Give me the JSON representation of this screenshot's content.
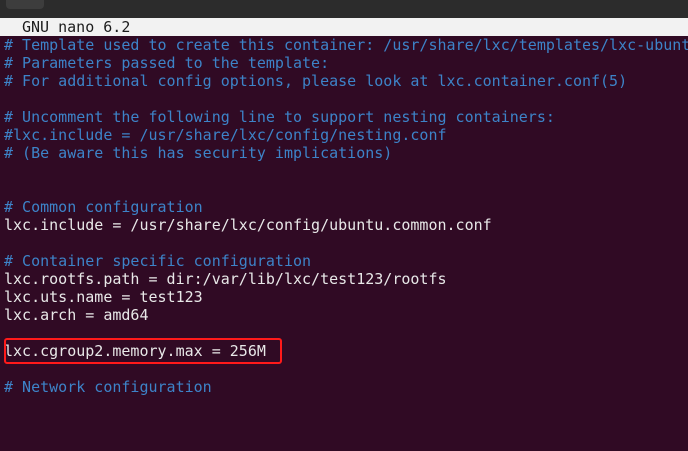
{
  "titlebar": {
    "text": "GNU nano 6.2"
  },
  "editor": {
    "lines": [
      {
        "kind": "comment",
        "text": "# Template used to create this container: /usr/share/lxc/templates/lxc-ubuntu"
      },
      {
        "kind": "comment",
        "text": "# Parameters passed to the template:"
      },
      {
        "kind": "comment",
        "text": "# For additional config options, please look at lxc.container.conf(5)"
      },
      {
        "kind": "blank",
        "text": ""
      },
      {
        "kind": "comment",
        "text": "# Uncomment the following line to support nesting containers:"
      },
      {
        "kind": "comment",
        "text": "#lxc.include = /usr/share/lxc/config/nesting.conf"
      },
      {
        "kind": "comment",
        "text": "# (Be aware this has security implications)"
      },
      {
        "kind": "blank",
        "text": ""
      },
      {
        "kind": "blank",
        "text": ""
      },
      {
        "kind": "comment",
        "text": "# Common configuration"
      },
      {
        "kind": "config",
        "text": "lxc.include = /usr/share/lxc/config/ubuntu.common.conf"
      },
      {
        "kind": "blank",
        "text": ""
      },
      {
        "kind": "comment",
        "text": "# Container specific configuration"
      },
      {
        "kind": "config",
        "text": "lxc.rootfs.path = dir:/var/lib/lxc/test123/rootfs"
      },
      {
        "kind": "config",
        "text": "lxc.uts.name = test123"
      },
      {
        "kind": "config",
        "text": "lxc.arch = amd64"
      },
      {
        "kind": "blank",
        "text": ""
      },
      {
        "kind": "config",
        "text": "lxc.cgroup2.memory.max = 256M"
      },
      {
        "kind": "blank",
        "text": ""
      },
      {
        "kind": "comment",
        "text": "# Network configuration"
      }
    ]
  },
  "highlight": {
    "line_index": 17,
    "color": "#ff1a1a"
  },
  "colors": {
    "background": "#300a24",
    "comment": "#3d83c8",
    "text": "#e8e8e8",
    "titlebar_bg": "#f2f2f2"
  }
}
